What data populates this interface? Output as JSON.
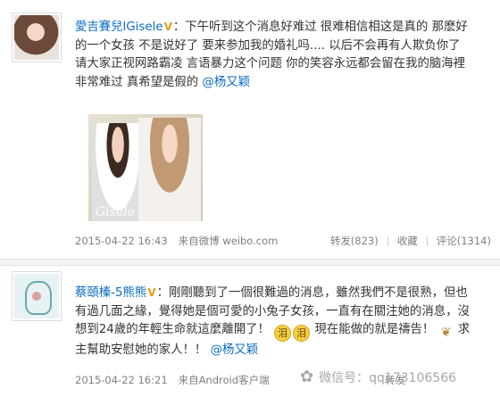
{
  "post1": {
    "username": "愛吉賽兒lGisele",
    "verified_badge": "V",
    "text_segments": [
      "：下午听到这个消息好难过  很难相信相这是真的  那麽好",
      "的一个女孩  不是说好了  要来参加我的婚礼吗.... 以后不会再有人欺负你了",
      "请大家正视网路霸凌  言语暴力这个问题  你的笑容永远都会留在我的脑海裡",
      "非常难过  真希望是假的  "
    ],
    "mention": "@杨又颖",
    "photo_watermark": "Gisele",
    "timestamp": "2015-04-22 16:43",
    "source": "来自微博 weibo.com",
    "repost": "转发(823)",
    "favorite": "收藏",
    "comment": "评论(1314)"
  },
  "post2": {
    "username": "蔡頤榛-5熊熊",
    "verified_badge": "V",
    "text_segments": [
      "：剛剛聽到了一個很難過的消息，雖然我們不是很熟，但也",
      "有過几面之緣，覺得她是個可愛的小兔子女孩，一直有在關注她的消息，沒",
      "想到24歲的年輕生命就這麼離開了！ ",
      " 現在能做的就是禱告！ ",
      " 求",
      "主幫助安慰她的家人！！ "
    ],
    "emoji_1": "泪",
    "emoji_2": "泪",
    "mention": "@杨又颖",
    "timestamp": "2015-04-22 16:21",
    "source": "来自Android客户端",
    "repost": "转发",
    "watermark": "微信号：qq173106566"
  }
}
